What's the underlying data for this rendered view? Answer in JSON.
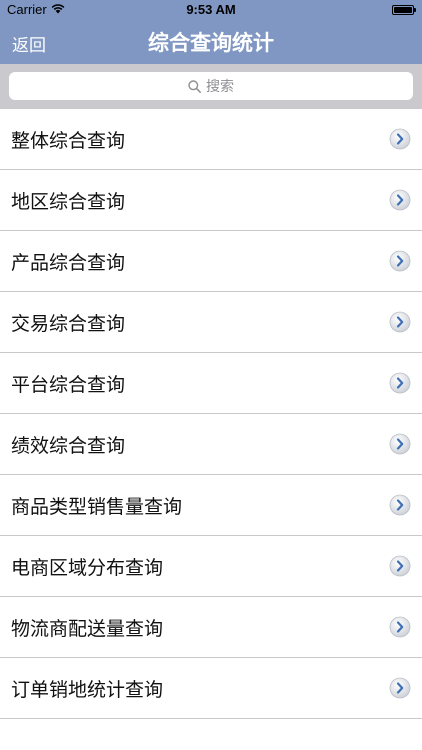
{
  "status_bar": {
    "carrier": "Carrier",
    "time": "9:53 AM",
    "battery_level": 1.0,
    "icons": [
      "wifi-icon",
      "battery-icon"
    ]
  },
  "nav_bar": {
    "back_label": "返回",
    "title": "综合查询统计",
    "background_color": "#7f97c2"
  },
  "search": {
    "placeholder": "搜索",
    "icon": "search-icon"
  },
  "list": {
    "items": [
      {
        "label": "整体综合查询"
      },
      {
        "label": "地区综合查询"
      },
      {
        "label": "产品综合查询"
      },
      {
        "label": "交易综合查询"
      },
      {
        "label": "平台综合查询"
      },
      {
        "label": "绩效综合查询"
      },
      {
        "label": "商品类型销售量查询"
      },
      {
        "label": "电商区域分布查询"
      },
      {
        "label": "物流商配送量查询"
      },
      {
        "label": "订单销地统计查询"
      }
    ],
    "accessory_icon": "chevron-right-icon"
  }
}
